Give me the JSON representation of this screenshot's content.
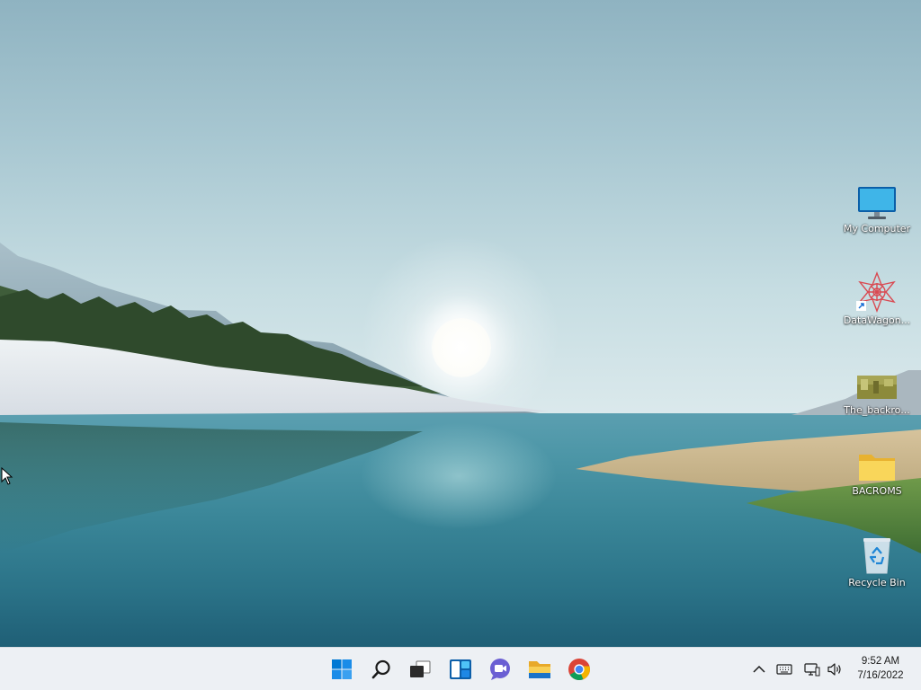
{
  "desktop": {
    "icons": [
      {
        "label": "My Computer",
        "icon": "monitor-icon"
      },
      {
        "label": "DataWagon...",
        "icon": "datawagon-shortcut-icon"
      },
      {
        "label": "The_backro...",
        "icon": "image-file-icon"
      },
      {
        "label": "BACROMS",
        "icon": "folder-icon"
      },
      {
        "label": "Recycle Bin",
        "icon": "recycle-bin-icon"
      }
    ]
  },
  "taskbar": {
    "pinned": [
      {
        "name": "Start",
        "icon": "windows-start-icon"
      },
      {
        "name": "Search",
        "icon": "search-icon"
      },
      {
        "name": "Task View",
        "icon": "task-view-icon"
      },
      {
        "name": "Widgets",
        "icon": "widgets-icon"
      },
      {
        "name": "Chat",
        "icon": "chat-icon"
      },
      {
        "name": "File Explorer",
        "icon": "file-explorer-icon"
      },
      {
        "name": "Google Chrome",
        "icon": "chrome-icon"
      }
    ],
    "tray": {
      "icons": [
        "chevron-up-icon",
        "keyboard-icon",
        "network-icon",
        "volume-icon"
      ],
      "time": "9:52 AM",
      "date": "7/16/2022"
    }
  },
  "colors": {
    "accent": "#0078d4",
    "taskbar_bg": "#edf0f4",
    "folder": "#f7c948"
  }
}
